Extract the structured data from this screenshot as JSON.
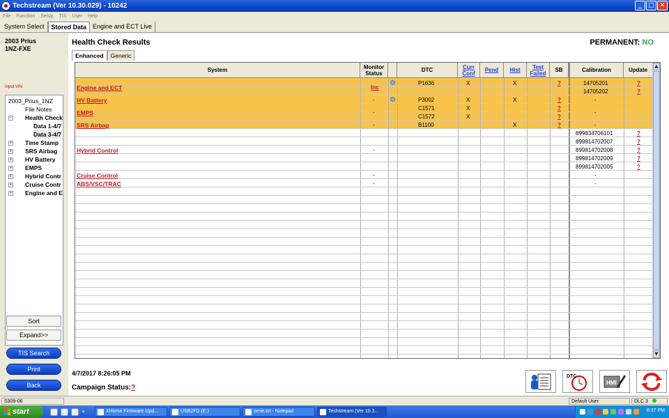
{
  "window": {
    "title": "Techstream (Ver 10.30.029) - 10242"
  },
  "menu": [
    "File",
    "Function",
    "Setup",
    "TIS",
    "User",
    "Help"
  ],
  "mode_tabs": [
    {
      "label": "System Select"
    },
    {
      "label": "Stored Data"
    },
    {
      "label": "Engine and ECT Live"
    }
  ],
  "vehicle": {
    "line1": "2003 Prius",
    "line2": "1NZ-FXE"
  },
  "input_vin": "Input VIN",
  "tree": [
    {
      "label": "2003_Prius_1NZ",
      "bold": false
    },
    {
      "label": "File Notes",
      "bold": false
    },
    {
      "label": "Health Check",
      "bold": true
    },
    {
      "label": "Data 1-4/7",
      "bold": true
    },
    {
      "label": "Data 3-4/7",
      "bold": true
    },
    {
      "label": "Time Stamp",
      "bold": true
    },
    {
      "label": "SRS Airbag",
      "bold": true
    },
    {
      "label": "HV Battery",
      "bold": true
    },
    {
      "label": "EMPS",
      "bold": true
    },
    {
      "label": "Hybrid Contr",
      "bold": true
    },
    {
      "label": "Cruise Contr",
      "bold": true
    },
    {
      "label": "Engine and E",
      "bold": true
    }
  ],
  "left_buttons": {
    "sort": "Sort",
    "expand": "Expand>>",
    "tis_search": "TIS Search",
    "print": "Print",
    "back": "Back"
  },
  "page": {
    "title": "Health Check Results",
    "permanent_label": "PERMANENT:",
    "permanent_value": "NO"
  },
  "subtabs": [
    {
      "label": "Enhanced"
    },
    {
      "label": "Generic"
    }
  ],
  "grid": {
    "headers": {
      "system": "System",
      "monitor": "Monitor Status",
      "dtc": "DTC",
      "curr": "Curr Conf",
      "pend": "Pend",
      "hist": "Hist",
      "test": "Test Failed",
      "sb": "SB",
      "calibration": "Calibration",
      "update": "Update"
    },
    "systems": [
      {
        "name": "Engine and ECT",
        "monitor": "Inc"
      },
      {
        "name": "HV Battery",
        "monitor": "-"
      },
      {
        "name": "EMPS",
        "monitor": "-"
      },
      {
        "name": "SRS Airbag",
        "monitor": "-"
      },
      {
        "name": "Hybrid Control",
        "monitor": "-"
      },
      {
        "name": "Cruise Control",
        "monitor": "-"
      },
      {
        "name": "ABS/VSC/TRAC",
        "monitor": "-"
      }
    ],
    "dtcs": [
      {
        "code": "P1636",
        "curr": "X",
        "hist": "X",
        "sb": "?"
      },
      {
        "code": "P3002",
        "curr": "X",
        "hist": "X",
        "sb": "?"
      },
      {
        "code": "C1571",
        "curr": "X",
        "hist": "",
        "sb": "?"
      },
      {
        "code": "C1572",
        "curr": "X",
        "hist": "",
        "sb": "?"
      },
      {
        "code": "B1100",
        "curr": "",
        "hist": "X",
        "sb": "?"
      }
    ],
    "calibrations": [
      {
        "cal": "14705201",
        "update": "?"
      },
      {
        "cal": "14705202",
        "update": "?"
      },
      {
        "cal": "-",
        "update": ""
      },
      {
        "cal": "-",
        "update": ""
      },
      {
        "cal": "-",
        "update": ""
      },
      {
        "cal": "899834706101",
        "update": "?"
      },
      {
        "cal": "899814702007",
        "update": "?"
      },
      {
        "cal": "899814702008",
        "update": "?"
      },
      {
        "cal": "899814702009",
        "update": "?"
      },
      {
        "cal": "899814702005",
        "update": "?"
      },
      {
        "cal": "-",
        "update": ""
      },
      {
        "cal": "-",
        "update": ""
      }
    ]
  },
  "status": {
    "timestamp": "4/7/2017 8:26:05 PM",
    "campaign_label": "Campaign Status:",
    "campaign_value": "?"
  },
  "statusbar": {
    "left": "S309-06",
    "user": "Default User",
    "dlc": "DLC 3"
  },
  "taskbar": {
    "start": "start",
    "items": [
      {
        "label": "XHorse Firmware Upd..."
      },
      {
        "label": "USB2FD (E:)"
      },
      {
        "label": "serie.txt - Notepad"
      },
      {
        "label": "Techstream (Ver 10.3..."
      }
    ],
    "clock": "8:37 PM"
  },
  "colors": {
    "highlight_row": "#f8c34a",
    "link_red": "#c0182a",
    "permanent_green": "#3aa34a",
    "title_blue": "#0a46c8"
  }
}
